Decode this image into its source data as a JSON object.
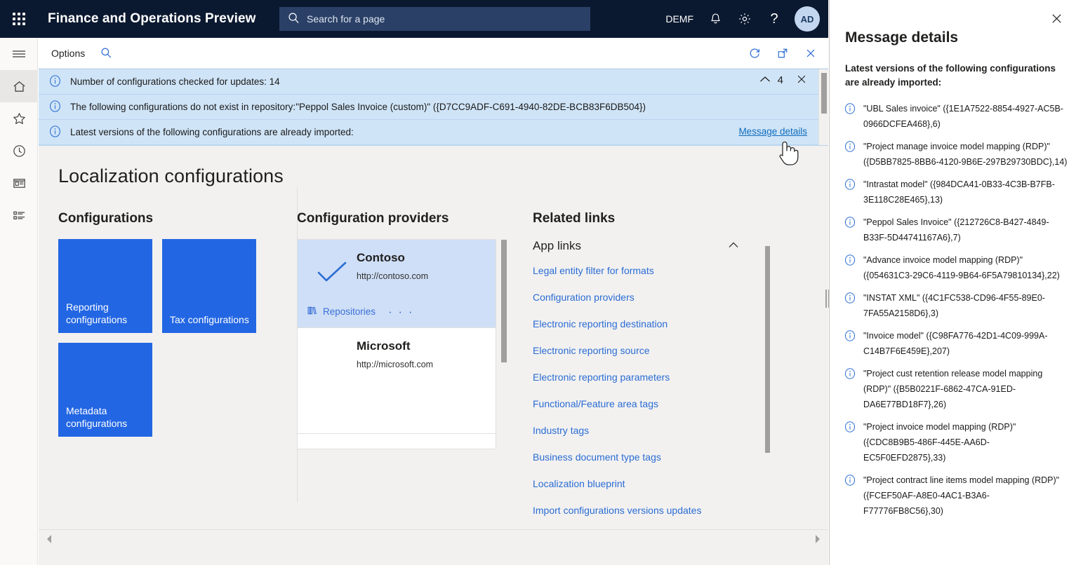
{
  "topbar": {
    "waffle_icon": "app-launcher-icon",
    "title": "Finance and Operations Preview",
    "search": {
      "placeholder": "Search for a page",
      "icon": "search-icon"
    },
    "company": "DEMF",
    "notifications_icon": "bell-icon",
    "settings_icon": "gear-icon",
    "help_icon": "question-mark-icon",
    "avatar_initials": "AD"
  },
  "rail": {
    "items": [
      {
        "name": "hamburger-menu",
        "icon": "hamburger-icon"
      },
      {
        "name": "home",
        "icon": "home-icon",
        "active": true
      },
      {
        "name": "favorites",
        "icon": "star-icon"
      },
      {
        "name": "recent",
        "icon": "clock-icon"
      },
      {
        "name": "workspaces",
        "icon": "workspace-icon"
      },
      {
        "name": "modules",
        "icon": "list-icon"
      }
    ]
  },
  "commandbar": {
    "options_label": "Options",
    "search_icon": "search-icon",
    "refresh_icon": "refresh-icon",
    "popout_icon": "open-in-new-window-icon",
    "close_icon": "close-icon"
  },
  "messagebar": {
    "collapse_icon": "chevron-up-icon",
    "count": "4",
    "close_icon": "close-icon",
    "details_link": "Message details",
    "messages": [
      {
        "icon": "info-icon",
        "text": "Number of configurations checked for updates: 14"
      },
      {
        "icon": "info-icon",
        "text": "The following configurations do not exist in repository:",
        "detail": "\"Peppol Sales Invoice (custom)\" ({D7CC9ADF-C691-4940-82DE-BCB83F6DB504})"
      },
      {
        "icon": "info-icon",
        "text": "Latest versions of the following configurations are already imported:"
      }
    ]
  },
  "page": {
    "title": "Localization configurations",
    "configurations": {
      "heading": "Configurations",
      "tiles": [
        {
          "label": "Reporting configurations"
        },
        {
          "label": "Tax configurations"
        },
        {
          "label": "Metadata configurations"
        }
      ]
    },
    "providers": {
      "heading": "Configuration providers",
      "items": [
        {
          "name": "Contoso",
          "url": "http://contoso.com",
          "selected": true,
          "check_icon": "checkmark-icon",
          "repositories_label": "Repositories",
          "repositories_icon": "books-icon",
          "more_label": "· · ·"
        },
        {
          "name": "Microsoft",
          "url": "http://microsoft.com",
          "selected": false
        }
      ]
    },
    "related_links": {
      "heading": "Related links",
      "group_title": "App links",
      "collapse_icon": "chevron-up-icon",
      "links": [
        "Legal entity filter for formats",
        "Configuration providers",
        "Electronic reporting destination",
        "Electronic reporting source",
        "Electronic reporting parameters",
        "Functional/Feature area tags",
        "Industry tags",
        "Business document type tags",
        "Localization blueprint",
        "Import configurations versions updates"
      ]
    },
    "hscroll": {
      "left_icon": "arrow-left-icon",
      "right_icon": "arrow-right-icon"
    }
  },
  "panel": {
    "close_icon": "close-icon",
    "title": "Message details",
    "subtitle": "Latest versions of the following configurations are already imported:",
    "entries": [
      {
        "icon": "info-icon",
        "text": "\"UBL Sales invoice\" ({1E1A7522-8854-4927-AC5B-0966DCFEA468},6)"
      },
      {
        "icon": "info-icon",
        "text": "\"Project manage invoice model mapping (RDP)\" ({D5BB7825-8BB6-4120-9B6E-297B29730BDC},14)"
      },
      {
        "icon": "info-icon",
        "text": "\"Intrastat model\" ({984DCA41-0B33-4C3B-B7FB-3E118C28E465},13)"
      },
      {
        "icon": "info-icon",
        "text": "\"Peppol Sales Invoice\" ({212726C8-B427-4849-B33F-5D44741167A6},7)"
      },
      {
        "icon": "info-icon",
        "text": "\"Advance invoice model mapping (RDP)\" ({054631C3-29C6-4119-9B64-6F5A79810134},22)"
      },
      {
        "icon": "info-icon",
        "text": "\"INSTAT XML\" ({4C1FC538-CD96-4F55-89E0-7FA55A2158D6},3)"
      },
      {
        "icon": "info-icon",
        "text": "\"Invoice model\" ({C98FA776-42D1-4C09-999A-C14B7F6E459E},207)"
      },
      {
        "icon": "info-icon",
        "text": "\"Project cust retention release model mapping (RDP)\" ({B5B0221F-6862-47CA-91ED-DA6E77BD18F7},26)"
      },
      {
        "icon": "info-icon",
        "text": "\"Project invoice model mapping (RDP)\" ({CDC8B9B5-486F-445E-AA6D-EC5F0EFD2875},33)"
      },
      {
        "icon": "info-icon",
        "text": "\"Project contract line items model mapping (RDP)\" ({FCEF50AF-A8E0-4AC1-B3A6-F77776FB8C56},30)"
      }
    ]
  },
  "colors": {
    "header_bg": "#0b1930",
    "search_bg": "#2b4066",
    "tile_blue": "#2266e3",
    "message_bg": "#cfe4f7",
    "link_blue": "#2b6cd4",
    "selected_row": "#cfdff7"
  }
}
